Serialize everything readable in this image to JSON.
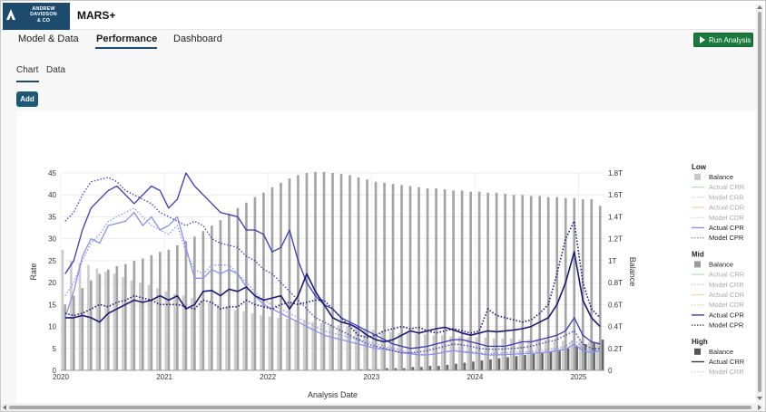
{
  "header": {
    "logo_lines": [
      "ANDREW",
      "DAVIDSON",
      "& CO"
    ],
    "app_title": "MARS+"
  },
  "nav": {
    "items": [
      {
        "label": "Model & Data"
      },
      {
        "label": "Performance"
      },
      {
        "label": "Dashboard"
      }
    ],
    "active": "Performance",
    "run_label": "Run Analysis"
  },
  "subtabs": {
    "items": [
      {
        "label": "Chart"
      },
      {
        "label": "Data"
      }
    ],
    "active": "Chart"
  },
  "add_label": "Add",
  "colors": {
    "brand": "#1d4b6e",
    "run_button": "#1a7a3d",
    "balance_low": "#c8c8c8",
    "balance_mid": "#9a9a9a",
    "balance_high": "#555555",
    "cpr_low": "#8a8ff0",
    "cpr_mid": "#3b3ab8",
    "cpr_high": "#1a1a7a",
    "crr": "#8fd18f",
    "cdr": "#f5c08a"
  },
  "chart_data": {
    "type": "line",
    "xlabel": "Analysis Date",
    "ylabel": "Rate",
    "y2label": "Balance",
    "xticks": [
      "2020",
      "2021",
      "2022",
      "2023",
      "2024",
      "2025"
    ],
    "xlim": [
      "2020-01",
      "2025-03"
    ],
    "ylim": [
      0,
      45
    ],
    "yticks": [
      0,
      5,
      10,
      15,
      20,
      25,
      30,
      35,
      40,
      45
    ],
    "y2lim": [
      0,
      1.8
    ],
    "y2ticks": [
      "0",
      "0.2T",
      "0.4T",
      "0.6T",
      "0.8T",
      "1T",
      "1.2T",
      "1.4T",
      "1.6T",
      "1.8T"
    ],
    "grid": true,
    "legend_position": "right",
    "legend": [
      {
        "group": "Low",
        "entries": [
          {
            "name": "Balance",
            "kind": "bar",
            "color": "#c8c8c8",
            "active": true
          },
          {
            "name": "Actual CRR",
            "kind": "solid",
            "color": "#8fd18f",
            "active": false
          },
          {
            "name": "Model CRR",
            "kind": "dot",
            "color": "#8fd18f",
            "active": false
          },
          {
            "name": "Actual CDR",
            "kind": "solid",
            "color": "#f5c08a",
            "active": false
          },
          {
            "name": "Model CDR",
            "kind": "dot",
            "color": "#f5c08a",
            "active": false
          },
          {
            "name": "Actual CPR",
            "kind": "solid",
            "color": "#8a8ff0",
            "active": true
          },
          {
            "name": "Model CPR",
            "kind": "dot",
            "color": "#8a8ff0",
            "active": true
          }
        ]
      },
      {
        "group": "Mid",
        "entries": [
          {
            "name": "Balance",
            "kind": "bar",
            "color": "#9a9a9a",
            "active": true
          },
          {
            "name": "Actual CRR",
            "kind": "solid",
            "color": "#8fd18f",
            "active": false
          },
          {
            "name": "Model CRR",
            "kind": "dot",
            "color": "#8fd18f",
            "active": false
          },
          {
            "name": "Actual CDR",
            "kind": "solid",
            "color": "#f5c08a",
            "active": false
          },
          {
            "name": "Model CDR",
            "kind": "dot",
            "color": "#f5c08a",
            "active": false
          },
          {
            "name": "Actual CPR",
            "kind": "solid",
            "color": "#3b3ab8",
            "active": true
          },
          {
            "name": "Model CPR",
            "kind": "dot",
            "color": "#3b3ab8",
            "active": true
          }
        ]
      },
      {
        "group": "High",
        "entries": [
          {
            "name": "Balance",
            "kind": "bar",
            "color": "#555555",
            "active": true
          },
          {
            "name": "Actual CRR",
            "kind": "solid",
            "color": "#3c3c3c",
            "active": true
          },
          {
            "name": "Model CRR",
            "kind": "dot",
            "color": "#8fd18f",
            "active": false
          }
        ]
      }
    ],
    "balance": {
      "low": [
        1.1,
        1.0,
        0.98,
        0.96,
        0.93,
        0.9,
        0.88,
        0.85,
        0.82,
        0.8,
        0.78,
        0.75,
        0.72,
        0.7,
        0.68,
        0.66,
        0.64,
        0.62,
        0.6,
        0.58,
        0.55,
        0.54,
        0.52,
        0.5,
        0.49,
        0.48,
        0.47,
        0.46,
        0.45,
        0.44,
        0.43,
        0.42,
        0.41,
        0.4,
        0.39,
        0.38,
        0.37,
        0.36,
        0.35,
        0.34,
        0.34,
        0.33,
        0.33,
        0.32,
        0.32,
        0.31,
        0.31,
        0.3,
        0.3,
        0.3,
        0.29,
        0.29,
        0.29,
        0.28,
        0.28,
        0.28,
        0.28,
        0.27,
        0.27,
        0.27,
        0.27,
        0.26,
        0.26
      ],
      "mid": [
        0.6,
        0.68,
        0.75,
        0.82,
        0.88,
        0.92,
        0.95,
        0.97,
        1.0,
        1.02,
        1.05,
        1.08,
        1.1,
        1.14,
        1.18,
        1.22,
        1.27,
        1.32,
        1.37,
        1.43,
        1.48,
        1.53,
        1.58,
        1.62,
        1.67,
        1.71,
        1.75,
        1.78,
        1.8,
        1.81,
        1.81,
        1.8,
        1.79,
        1.78,
        1.76,
        1.74,
        1.72,
        1.71,
        1.7,
        1.69,
        1.68,
        1.67,
        1.66,
        1.66,
        1.65,
        1.64,
        1.64,
        1.63,
        1.63,
        1.62,
        1.62,
        1.61,
        1.6,
        1.6,
        1.59,
        1.59,
        1.58,
        1.58,
        1.57,
        1.57,
        1.56,
        1.56,
        1.5
      ],
      "high": [
        0,
        0,
        0,
        0,
        0,
        0,
        0,
        0,
        0,
        0,
        0,
        0,
        0,
        0,
        0,
        0,
        0,
        0,
        0,
        0,
        0,
        0,
        0,
        0,
        0,
        0,
        0,
        0,
        0,
        0,
        0,
        0,
        0,
        0,
        0.01,
        0.01,
        0.01,
        0.02,
        0.02,
        0.02,
        0.03,
        0.03,
        0.04,
        0.04,
        0.05,
        0.06,
        0.07,
        0.08,
        0.09,
        0.1,
        0.11,
        0.12,
        0.13,
        0.14,
        0.15,
        0.16,
        0.17,
        0.18,
        0.2,
        0.22,
        0.24,
        0.26,
        0.28
      ]
    },
    "series": [
      {
        "name": "Actual CPR",
        "group": "Low",
        "style": "solid",
        "color": "#8a8ff0",
        "values": [
          12,
          18,
          26,
          30,
          29,
          33,
          33.5,
          34,
          36,
          33,
          35,
          32,
          33,
          35,
          28,
          21,
          21,
          23,
          22,
          23,
          22,
          19,
          17,
          15,
          14,
          13,
          12,
          11,
          10,
          9,
          8,
          7.5,
          7,
          6.5,
          6,
          5.5,
          5,
          4.8,
          4.5,
          4,
          3.8,
          3.5,
          3.5,
          3.8,
          4.2,
          4.5,
          4.2,
          4,
          3.8,
          3.5,
          3.5,
          3.6,
          3.7,
          3.8,
          3.9,
          4,
          4.2,
          4.5,
          4.8,
          6,
          4.5,
          4,
          4.5
        ]
      },
      {
        "name": "Model CPR",
        "group": "Low",
        "style": "dot",
        "color": "#8a8ff0",
        "values": [
          17,
          20,
          25,
          29,
          31,
          34,
          35,
          36,
          37,
          35,
          33,
          32,
          31,
          33,
          27,
          23,
          22,
          24,
          24,
          24,
          22,
          20,
          18,
          16,
          15,
          14,
          13,
          12,
          11,
          10,
          9,
          8.5,
          8,
          7.5,
          7,
          6.5,
          6,
          5.5,
          5,
          4.5,
          4,
          3.8,
          3.5,
          3.8,
          4.2,
          4.5,
          4.4,
          4.2,
          4,
          3.8,
          3.9,
          4,
          4.1,
          4.2,
          4.3,
          4.5,
          4.8,
          5,
          5.5,
          7,
          5,
          4.5,
          4.8
        ]
      },
      {
        "name": "Actual CPR",
        "group": "Mid",
        "style": "solid",
        "color": "#3b3ab8",
        "values": [
          22,
          25,
          32,
          37,
          39,
          41,
          42,
          40,
          38,
          40,
          42,
          41,
          37,
          39,
          45,
          42,
          40,
          38,
          36,
          35.5,
          35,
          32,
          32,
          31,
          27,
          28,
          32,
          25,
          20,
          17,
          15,
          14,
          12,
          11,
          10,
          9,
          8,
          7,
          6,
          5.5,
          5,
          5.2,
          5.5,
          6,
          6.5,
          7,
          7,
          6.5,
          6,
          5.5,
          5.5,
          5.5,
          6,
          6.5,
          6.5,
          7,
          7.5,
          8,
          9,
          12,
          8,
          6.5,
          6
        ]
      },
      {
        "name": "Model CPR",
        "group": "Mid",
        "style": "dot",
        "color": "#3b3ab8",
        "values": [
          34,
          36,
          40,
          43,
          43.5,
          44,
          43,
          41,
          40,
          39,
          38,
          36,
          35,
          34,
          33,
          34,
          33,
          30,
          29,
          28.5,
          28,
          26,
          25,
          23,
          22,
          20,
          18,
          16,
          14,
          12,
          11,
          10,
          9,
          8,
          7,
          6,
          5.5,
          5,
          4.5,
          4,
          4,
          4.2,
          4.5,
          5,
          5.5,
          6,
          5.8,
          5.5,
          5,
          4.8,
          4.8,
          4.9,
          5,
          5.2,
          5.5,
          6,
          6.5,
          7,
          8,
          9,
          6,
          5,
          5
        ]
      },
      {
        "name": "Actual CPR",
        "group": "High",
        "style": "solid",
        "color": "#1a1a7a",
        "values": [
          12,
          12,
          12.5,
          12,
          11,
          13,
          14,
          15,
          16,
          15.5,
          16,
          17,
          16,
          17,
          14,
          15,
          18,
          18.2,
          17,
          18.5,
          18,
          19,
          17,
          16,
          16.5,
          17,
          14,
          17,
          22,
          18,
          15,
          12,
          11,
          10.5,
          9.5,
          8,
          7,
          6.5,
          7,
          8,
          9,
          8.5,
          9,
          9.5,
          9.8,
          9.2,
          8.5,
          8,
          8.5,
          9,
          8.8,
          9,
          9.2,
          9.5,
          10,
          11,
          12,
          15,
          20,
          27,
          16,
          12,
          10
        ]
      },
      {
        "name": "Model CPR",
        "group": "High",
        "style": "dot",
        "color": "#1a1a7a",
        "values": [
          13,
          12.5,
          13,
          14,
          15,
          14.5,
          15.5,
          16,
          17,
          16.5,
          16,
          15,
          15,
          15,
          14.5,
          14,
          16,
          15.5,
          14,
          14.5,
          14.5,
          16,
          15,
          14.5,
          14,
          15,
          15.5,
          15,
          15.5,
          16,
          16,
          14,
          12,
          10,
          8,
          7.5,
          8,
          9,
          9.5,
          10,
          9.5,
          9.8,
          9,
          8.5,
          9,
          9.5,
          9,
          8.5,
          9,
          14,
          12.5,
          12,
          11.5,
          11,
          11.5,
          13,
          15,
          22,
          30,
          34,
          20,
          14,
          12
        ]
      }
    ]
  }
}
